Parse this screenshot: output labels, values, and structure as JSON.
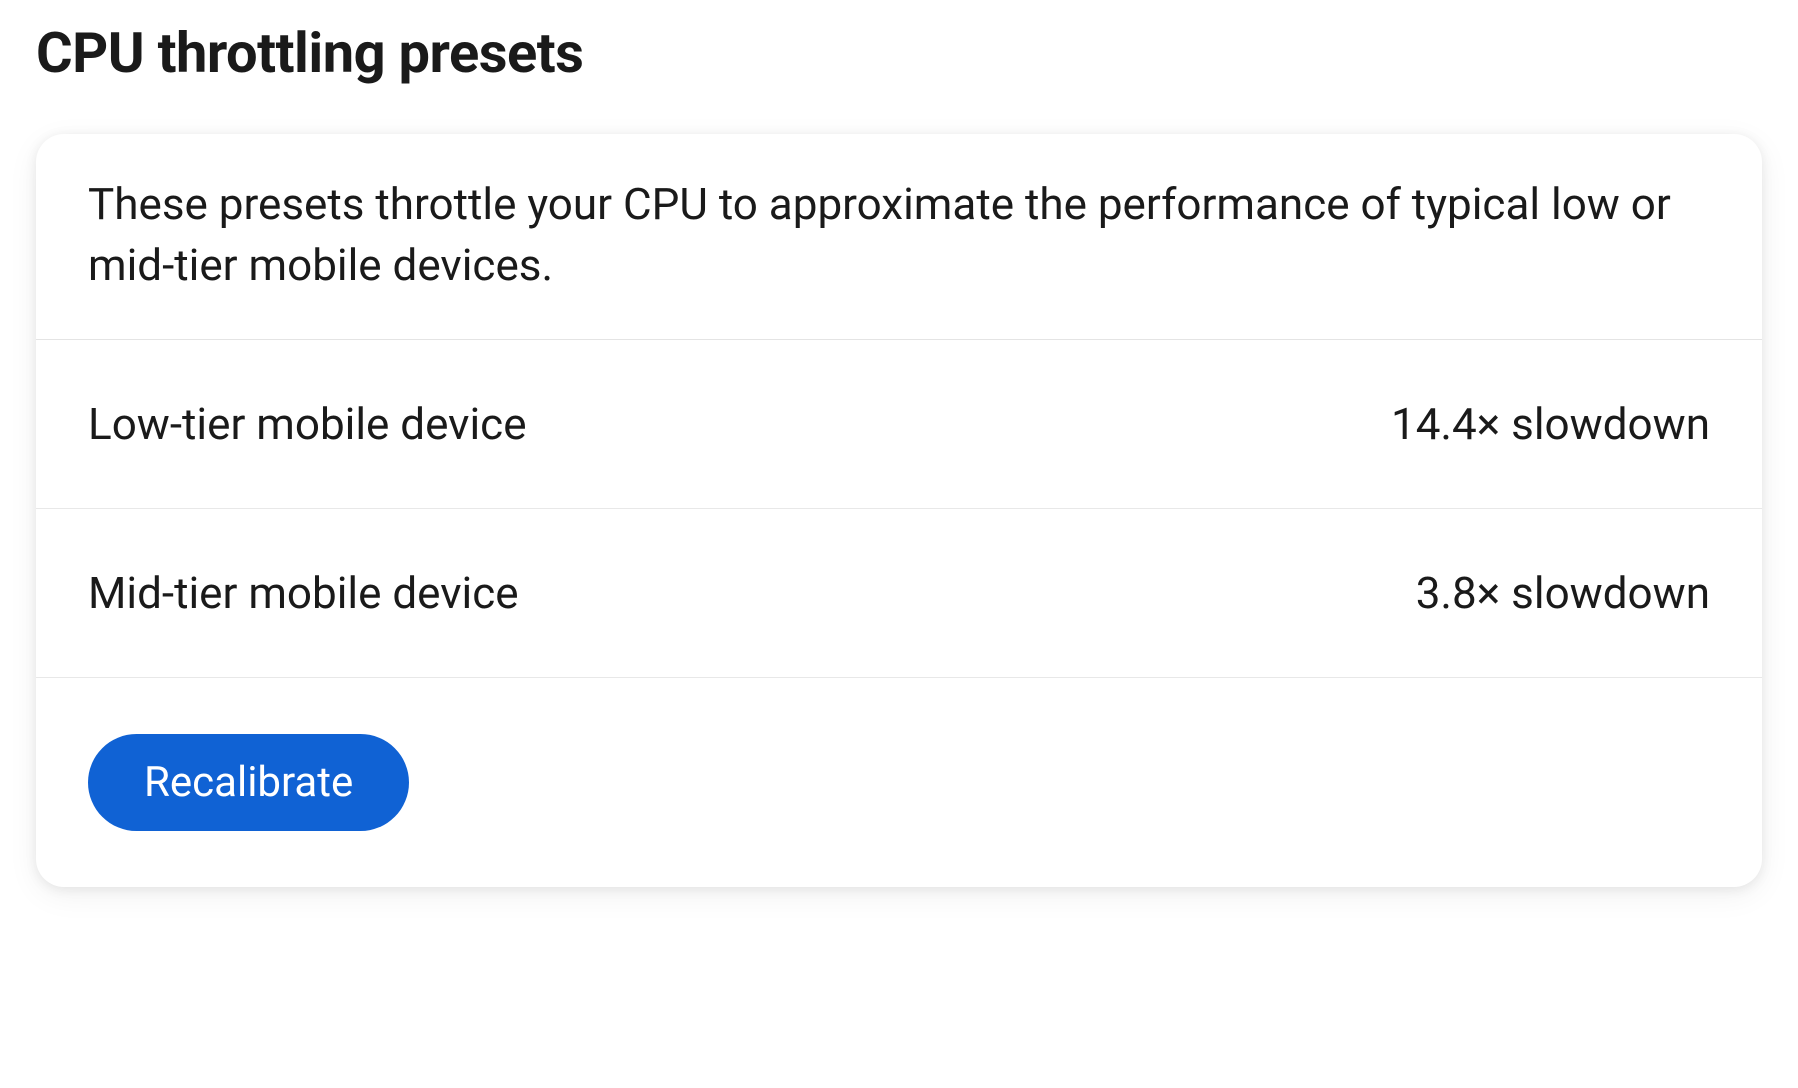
{
  "header": {
    "title": "CPU throttling presets"
  },
  "card": {
    "description": "These presets throttle your CPU to approximate the performance of typical low or mid-tier mobile devices.",
    "presets": [
      {
        "name": "Low-tier mobile device",
        "value": "14.4× slowdown"
      },
      {
        "name": "Mid-tier mobile device",
        "value": "3.8× slowdown"
      }
    ],
    "recalibrate_label": "Recalibrate"
  }
}
